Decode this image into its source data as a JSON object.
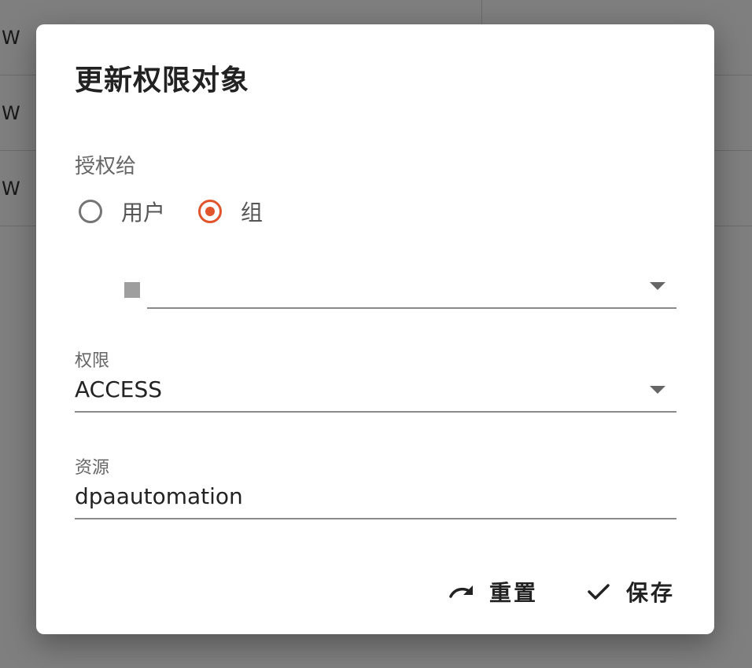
{
  "background": {
    "rows": [
      {
        "text": "W"
      },
      {
        "text": "W"
      },
      {
        "text": "W"
      }
    ]
  },
  "dialog": {
    "title": "更新权限对象",
    "grant_to": {
      "label": "授权给",
      "options": [
        {
          "label": "用户",
          "checked": false
        },
        {
          "label": "组",
          "checked": true
        }
      ]
    },
    "group_select": {
      "value": ""
    },
    "permission": {
      "label": "权限",
      "value": "ACCESS"
    },
    "resource": {
      "label": "资源",
      "value": "dpaautomation"
    },
    "actions": {
      "reset_label": "重置",
      "save_label": "保存"
    }
  },
  "colors": {
    "accent": "#e0552b",
    "overlay": "rgba(0,0,0,0.5)"
  }
}
